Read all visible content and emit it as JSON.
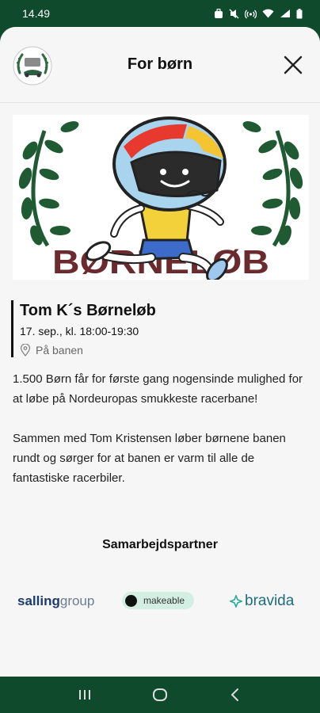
{
  "status_bar": {
    "time": "14.49"
  },
  "header": {
    "title": "For børn"
  },
  "event": {
    "title": "Tom K´s Børneløb",
    "date": "17. sep., kl. 18:00-19:30",
    "location": "På banen"
  },
  "description": {
    "paragraphs": [
      "1.500 Børn får for første gang nogensinde mulighed for at løbe på Nordeuropas smukkeste racerbane!",
      "Sammen med Tom Kristensen løber børnene banen rundt og sørger for at banen er varm til alle de fantastiske racerbiler."
    ]
  },
  "partners": {
    "heading": "Samarbejdspartner",
    "items": [
      {
        "part1": "salling",
        "part2": "group"
      },
      {
        "name": "makeable"
      },
      {
        "name": "bravida"
      }
    ]
  },
  "hero": {
    "banner_text": "BØRNELØB"
  },
  "colors": {
    "brand_green": "#0f4a2c",
    "sheet_bg": "#f6f6f6",
    "wreath_green": "#1f5a33",
    "banner_maroon": "#6b2a2e"
  }
}
